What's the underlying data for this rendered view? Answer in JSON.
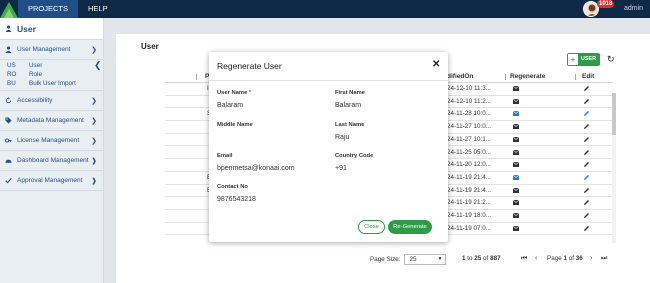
{
  "topbar": {
    "nav": [
      "PROJECTS",
      "HELP"
    ],
    "notification_count": "1018",
    "user": "admin"
  },
  "sidebar": {
    "title": "User",
    "groups": [
      {
        "label": "User Management",
        "icon": "user-icon",
        "sub": [
          {
            "code": "US",
            "label": "User"
          },
          {
            "code": "RO",
            "label": "Role"
          },
          {
            "code": "BU",
            "label": "Bulk User Import"
          }
        ]
      },
      {
        "label": "Accessibility",
        "icon": "refresh-icon"
      },
      {
        "label": "Metadata Management",
        "icon": "tag-icon"
      },
      {
        "label": "License Management",
        "icon": "key-icon"
      },
      {
        "label": "Dashboard Management",
        "icon": "dashboard-icon"
      },
      {
        "label": "Approval Management",
        "icon": "check-icon"
      }
    ]
  },
  "page": {
    "title": "User",
    "add_user_label": "USER"
  },
  "table": {
    "columns": [
      "P",
      "difiedOn",
      "Regenerate",
      "Edit"
    ],
    "rows": [
      {
        "left": "I",
        "date": "24-12-10 11:3..."
      },
      {
        "left": "",
        "date": "24-12-10 11:2..."
      },
      {
        "left": "S",
        "date": "24-11-28 10:0..."
      },
      {
        "left": "",
        "date": "24-11-27 10:0..."
      },
      {
        "left": "",
        "date": "24-11-27 10:1..."
      },
      {
        "left": "",
        "date": "24-11-25 05:0..."
      },
      {
        "left": "",
        "date": "24-11-20 12:0..."
      },
      {
        "left": "E",
        "date": "24-11-19 21:4..."
      },
      {
        "left": "E",
        "date": "24-11-19 21:4..."
      },
      {
        "left": "",
        "date": "24-11-19 21:2..."
      },
      {
        "left": "",
        "date": "24-11-19 18:0..."
      },
      {
        "left": "",
        "date": "24-11-19 07:0..."
      }
    ]
  },
  "pager": {
    "page_size_label": "Page Size:",
    "page_size": "25",
    "range_from": "1",
    "range_to_word": "to",
    "range_to": "25",
    "of_word": "of",
    "total": "887",
    "page_word": "Page",
    "page": "1",
    "pages": "36"
  },
  "modal": {
    "title": "Regenerate User",
    "fields": {
      "user_name": {
        "label": "User Name",
        "value": "Balaram"
      },
      "first_name": {
        "label": "First Name",
        "value": "Balaram"
      },
      "middle_name": {
        "label": "Middle Name",
        "value": ""
      },
      "last_name": {
        "label": "Last Name",
        "value": "Raju"
      },
      "email": {
        "label": "Email",
        "value": "bpenmetsa@konaai.com"
      },
      "country_code": {
        "label": "Country Code",
        "value": "+91"
      },
      "contact_no": {
        "label": "Contact No",
        "value": "9876543218"
      }
    },
    "close_label": "Close",
    "regenerate_label": "Re-Generate"
  },
  "colors": {
    "topbar": "#0e2a47",
    "accent_blue": "#1f4f86",
    "green": "#2f9b4a",
    "badge_red": "#d9362b"
  }
}
